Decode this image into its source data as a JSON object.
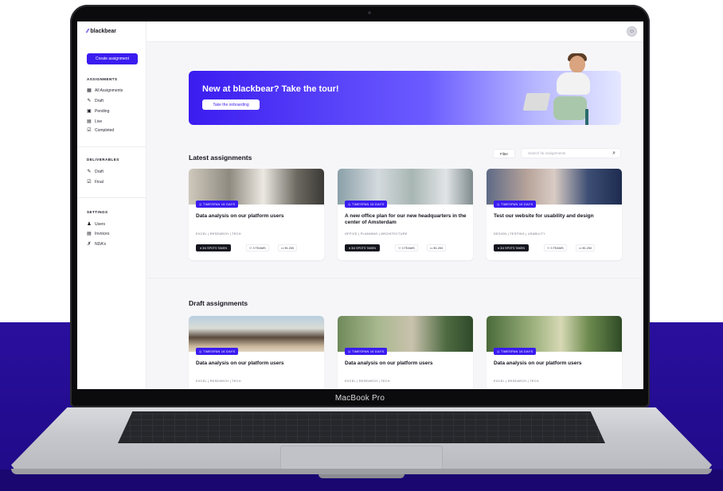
{
  "device": {
    "label": "MacBook Pro"
  },
  "app": {
    "logo": "blackbear",
    "create_button": "Create assignment",
    "sections": [
      {
        "title": "ASSIGNMENTS",
        "items": [
          {
            "icon": "grid-icon",
            "label": "All Assignments"
          },
          {
            "icon": "pencil-icon",
            "label": "Draft"
          },
          {
            "icon": "pending-icon",
            "label": "Pending"
          },
          {
            "icon": "live-icon",
            "label": "Live"
          },
          {
            "icon": "check-icon",
            "label": "Completed"
          }
        ]
      },
      {
        "title": "DELIVERABLES",
        "items": [
          {
            "icon": "pencil-icon",
            "label": "Draft"
          },
          {
            "icon": "check-icon",
            "label": "Final"
          }
        ]
      },
      {
        "title": "SETTINGS",
        "items": [
          {
            "icon": "user-icon",
            "label": "Users"
          },
          {
            "icon": "invoice-icon",
            "label": "Invoices"
          },
          {
            "icon": "nda-icon",
            "label": "NDA's"
          }
        ]
      }
    ],
    "banner": {
      "title": "New at blackbear? Take the tour!",
      "button": "Take the onboarding"
    },
    "latest": {
      "title": "Latest assignments",
      "filter": "Filter",
      "search_placeholder": "Search for assignments",
      "cards": [
        {
          "timespan": "TIMESPAN 16 DAYS",
          "title": "Data analysis on our platform users",
          "tags": "EXCEL | RESEARCH | TECH",
          "spots": "3/4 SPOTS TAKEN",
          "teams": "3 TEAMS",
          "price": "€1.200"
        },
        {
          "timespan": "TIMESPAN 16 DAYS",
          "title": "A new office plan for our new headquarters in the center of Amsterdam",
          "tags": "OFFICE | PLANNING | ARCHITECTURE",
          "spots": "3/4 SPOTS TAKEN",
          "teams": "3 TEAMS",
          "price": "€1.200"
        },
        {
          "timespan": "TIMESPAN 16 DAYS",
          "title": "Test our website for usability and design",
          "tags": "DESIGN | TESTING | USABILITY",
          "spots": "3/4 SPOTS TAKEN",
          "teams": "3 TEAMS",
          "price": "€1.200"
        }
      ]
    },
    "draft": {
      "title": "Draft assignments",
      "cards": [
        {
          "timespan": "TIMESPAN 16 DAYS",
          "title": "Data analysis on our platform users",
          "tags": "EXCEL | RESEARCH | TECH"
        },
        {
          "timespan": "TIMESPAN 16 DAYS",
          "title": "Data analysis on our platform users",
          "tags": "EXCEL | RESEARCH | TECH"
        },
        {
          "timespan": "TIMESPAN 16 DAYS",
          "title": "Data analysis on our platform users",
          "tags": "EXCEL | RESEARCH | TECH"
        }
      ]
    }
  },
  "colors": {
    "accent": "#3a1cf0",
    "background": "#2a0f9e",
    "dark": "#15151f"
  }
}
